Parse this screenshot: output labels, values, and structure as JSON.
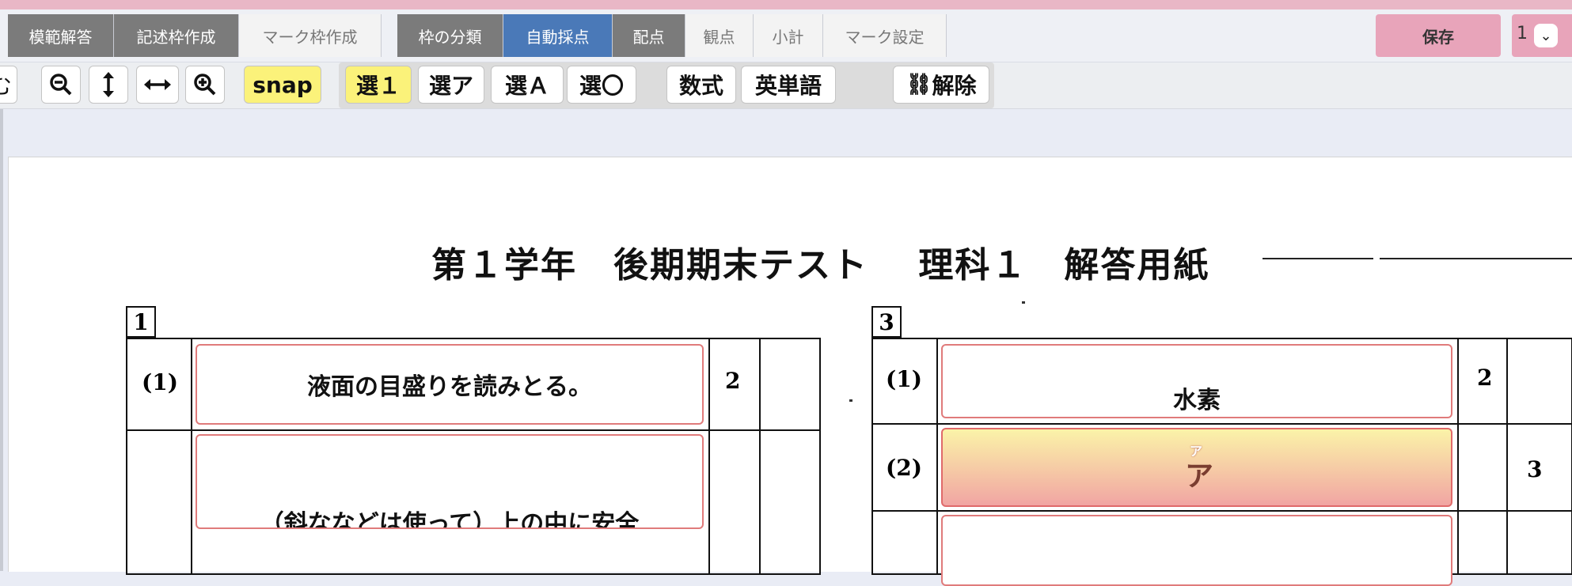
{
  "tabs_left": [
    "模範解答",
    "記述枠作成",
    "マーク枠作成"
  ],
  "tabs_mid": [
    "枠の分類",
    "自動採点",
    "配点",
    "観点",
    "小計",
    "マーク設定"
  ],
  "save_label": "保存",
  "right_glyph": "1",
  "toolbar": {
    "edge_glyph": "む",
    "snap": "snap",
    "sel1": "選１",
    "selA_kana": "選ア",
    "selA": "選Ａ",
    "selO": "選〇",
    "formula": "数式",
    "english": "英単語",
    "release": "解除"
  },
  "document": {
    "title": "第１学年　後期期末テスト　 理科１　解答用紙",
    "section1": {
      "num": "1",
      "rows": [
        {
          "label": "(1)",
          "answer": "液面の目盛りを読みとる。",
          "score": "2"
        },
        {
          "label": "",
          "answer": "（斜ななどは使って）上の中に安全",
          "score": ""
        }
      ]
    },
    "section3": {
      "num": "3",
      "rows": [
        {
          "label": "(1)",
          "answer": "水素",
          "score": "2",
          "score2": ""
        },
        {
          "label": "(2)",
          "answer": "ア",
          "ruby": "ア",
          "score": "",
          "score2": "3"
        }
      ]
    }
  },
  "colors": {
    "active_tab": "#4a79b8",
    "dark_tab": "#7b7b7b",
    "save": "#e8a4ba",
    "highlight": "#fbf27a",
    "answer_border": "#e07b7b"
  }
}
